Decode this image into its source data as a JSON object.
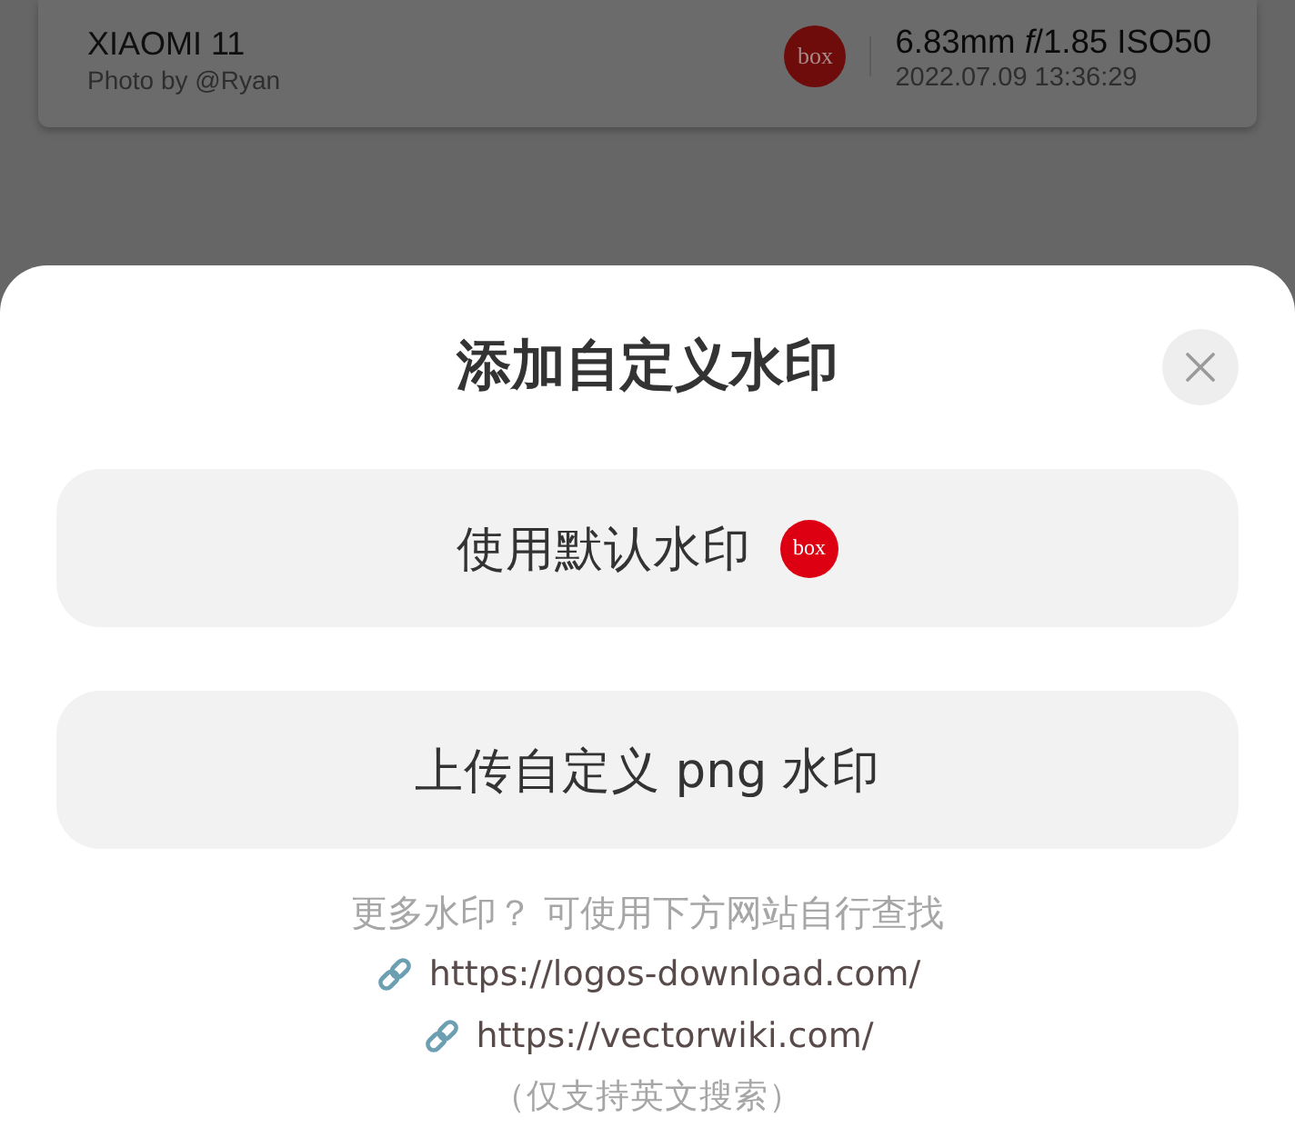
{
  "photo_card": {
    "model": "XIAOMI 11",
    "credit": "Photo by @Ryan",
    "logo_text": "box",
    "exif": "6.83mm *f*/1.85 ISO50",
    "timestamp": "2022.07.09 13:36:29"
  },
  "sheet": {
    "title": "添加自定义水印",
    "options": [
      {
        "label": "使用默认水印",
        "logo_text": "box"
      },
      {
        "label": "上传自定义 png 水印"
      }
    ],
    "hint": "更多水印？ 可使用下方网站自行查找",
    "links": [
      {
        "url": "https://logos-download.com/"
      },
      {
        "url": "https://vectorwiki.com/"
      }
    ],
    "note": "（仅支持英文搜索）"
  }
}
